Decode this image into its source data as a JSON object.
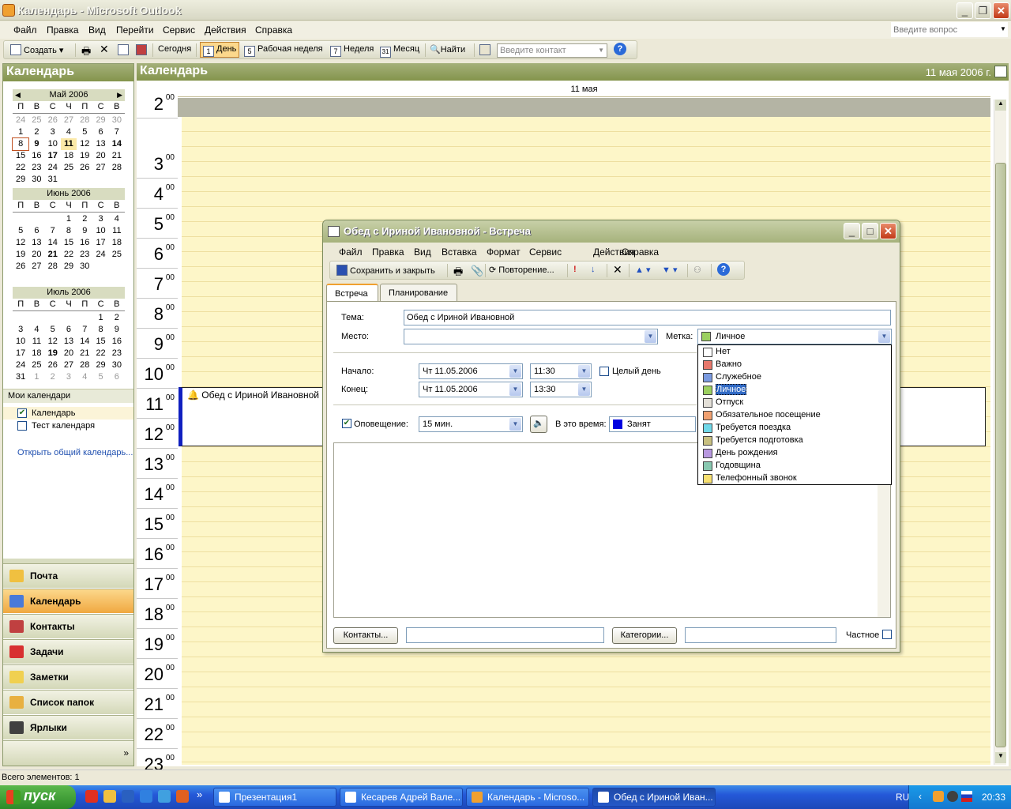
{
  "window": {
    "title": "Календарь - Microsoft Outlook"
  },
  "menu": [
    "Файл",
    "Правка",
    "Вид",
    "Перейти",
    "Сервис",
    "Действия",
    "Справка"
  ],
  "ask_placeholder": "Введите вопрос",
  "toolbar": {
    "create": "Создать",
    "today": "Сегодня",
    "day_num": "1",
    "day": "День",
    "workweek_num": "5",
    "workweek": "Рабочая неделя",
    "week_num": "7",
    "week": "Неделя",
    "month_num": "31",
    "month": "Месяц",
    "find": "Найти",
    "contact_placeholder": "Введите контакт"
  },
  "left": {
    "title": "Календарь",
    "dow": [
      "П",
      "В",
      "С",
      "Ч",
      "П",
      "С",
      "В"
    ],
    "months": [
      {
        "name": "Май 2006",
        "weeks": [
          [
            "24",
            "25",
            "26",
            "27",
            "28",
            "29",
            "30"
          ],
          [
            "1",
            "2",
            "3",
            "4",
            "5",
            "6",
            "7"
          ],
          [
            "8",
            "9",
            "10",
            "11",
            "12",
            "13",
            "14"
          ],
          [
            "15",
            "16",
            "17",
            "18",
            "19",
            "20",
            "21"
          ],
          [
            "22",
            "23",
            "24",
            "25",
            "26",
            "27",
            "28"
          ],
          [
            "29",
            "30",
            "31",
            "",
            "",
            "",
            ""
          ]
        ]
      },
      {
        "name": "Июнь 2006",
        "weeks": [
          [
            "",
            "",
            "",
            "1",
            "2",
            "3",
            "4"
          ],
          [
            "5",
            "6",
            "7",
            "8",
            "9",
            "10",
            "11"
          ],
          [
            "12",
            "13",
            "14",
            "15",
            "16",
            "17",
            "18"
          ],
          [
            "19",
            "20",
            "21",
            "22",
            "23",
            "24",
            "25"
          ],
          [
            "26",
            "27",
            "28",
            "29",
            "30",
            "",
            ""
          ]
        ]
      },
      {
        "name": "Июль 2006",
        "weeks": [
          [
            "",
            "",
            "",
            "",
            "",
            "1",
            "2"
          ],
          [
            "3",
            "4",
            "5",
            "6",
            "7",
            "8",
            "9"
          ],
          [
            "10",
            "11",
            "12",
            "13",
            "14",
            "15",
            "16"
          ],
          [
            "17",
            "18",
            "19",
            "20",
            "21",
            "22",
            "23"
          ],
          [
            "24",
            "25",
            "26",
            "27",
            "28",
            "29",
            "30"
          ],
          [
            "31",
            "1",
            "2",
            "3",
            "4",
            "5",
            "6"
          ]
        ]
      }
    ],
    "my_calendars": "Мои календари",
    "calendars": [
      {
        "name": "Календарь",
        "checked": true
      },
      {
        "name": "Тест календаря",
        "checked": false
      }
    ],
    "open_shared": "Открыть общий календарь...",
    "nav": [
      "Почта",
      "Календарь",
      "Контакты",
      "Задачи",
      "Заметки",
      "Список папок",
      "Ярлыки"
    ]
  },
  "main": {
    "title": "Календарь",
    "date": "11 мая 2006 г.",
    "day_header": "11 мая",
    "hours": [
      "2",
      "3",
      "4",
      "5",
      "6",
      "7",
      "8",
      "9",
      "10",
      "11",
      "12",
      "13",
      "14",
      "15",
      "16",
      "17",
      "18",
      "19",
      "20",
      "21",
      "22",
      "23"
    ],
    "minutes": "00",
    "appointment": "Обед с Ириной Ивановной"
  },
  "status": "Всего элементов: 1",
  "taskbar": {
    "start": "пуск",
    "tasks": [
      "Презентация1",
      "Кесарев Адрей Вале...",
      "Календарь - Microso...",
      "Обед с Ириной Иван..."
    ],
    "lang": "RU",
    "clock": "20:33"
  },
  "dialog": {
    "title": "Обед с Ириной Ивановной - Встреча",
    "menu": [
      "Файл",
      "Правка",
      "Вид",
      "Вставка",
      "Формат",
      "Сервис",
      "Действия",
      "Справка"
    ],
    "save_close": "Сохранить и закрыть",
    "recurrence": "Повторение...",
    "tabs": [
      "Встреча",
      "Планирование"
    ],
    "subject_label": "Тема:",
    "subject": "Обед с Ириной Ивановной",
    "location_label": "Место:",
    "location": "",
    "label_label": "Метка:",
    "label_value": "Личное",
    "start_label": "Начало:",
    "start_date": "Чт 11.05.2006",
    "start_time": "11:30",
    "allday": "Целый день",
    "end_label": "Конец:",
    "end_date": "Чт 11.05.2006",
    "end_time": "13:30",
    "reminder_label": "Оповещение:",
    "reminder": "15 мин.",
    "showas_label": "В это время:",
    "showas": "Занят",
    "contacts_btn": "Контакты...",
    "categories_btn": "Категории...",
    "private": "Частное",
    "labels": [
      {
        "name": "Нет",
        "color": "#ffffff"
      },
      {
        "name": "Важно",
        "color": "#e8786c"
      },
      {
        "name": "Служебное",
        "color": "#7a9ae0"
      },
      {
        "name": "Личное",
        "color": "#9cd060"
      },
      {
        "name": "Отпуск",
        "color": "#e4e0d8"
      },
      {
        "name": "Обязательное посещение",
        "color": "#f0a070"
      },
      {
        "name": "Требуется поездка",
        "color": "#70d8e8"
      },
      {
        "name": "Требуется подготовка",
        "color": "#c8c080"
      },
      {
        "name": "День рождения",
        "color": "#b898e0"
      },
      {
        "name": "Годовщина",
        "color": "#88c8b0"
      },
      {
        "name": "Телефонный звонок",
        "color": "#f8e070"
      }
    ]
  }
}
